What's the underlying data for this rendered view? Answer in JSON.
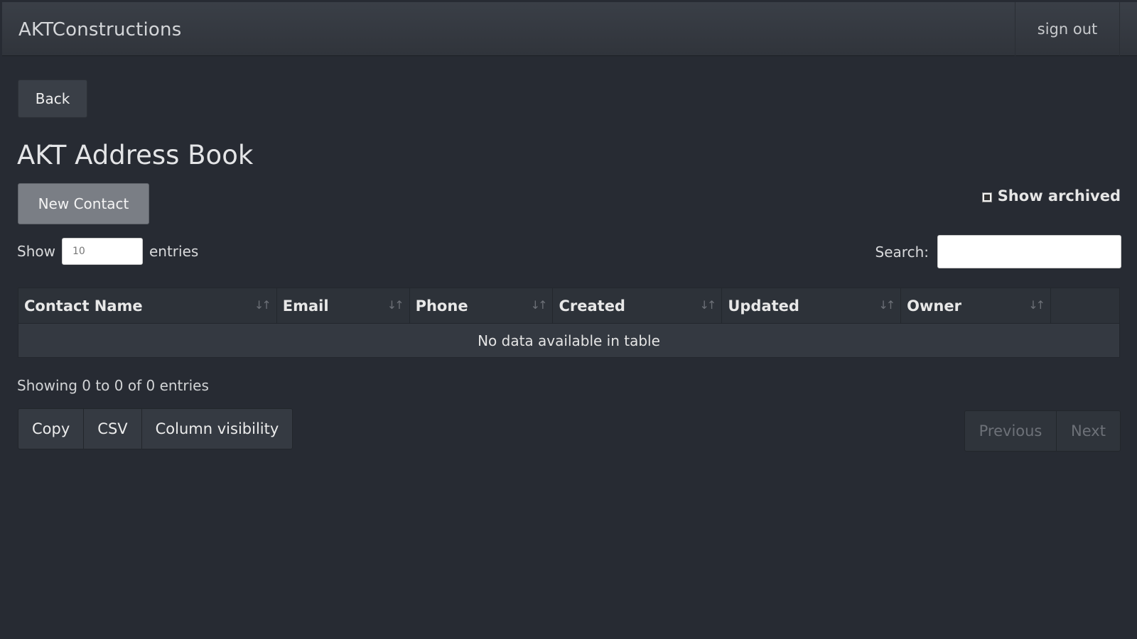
{
  "navbar": {
    "brand": "AKTConstructions",
    "sign_out": "sign out"
  },
  "back_label": "Back",
  "page_title": "AKT Address Book",
  "new_contact_label": "New Contact",
  "show_archived_label": "Show archived",
  "length": {
    "show_label": "Show",
    "value": "10",
    "entries_label": "entries"
  },
  "search": {
    "label": "Search:",
    "value": ""
  },
  "table": {
    "columns": [
      "Contact Name",
      "Email",
      "Phone",
      "Created",
      "Updated",
      "Owner",
      ""
    ],
    "empty_message": "No data available in table"
  },
  "info_text": "Showing 0 to 0 of 0 entries",
  "export_buttons": [
    "Copy",
    "CSV",
    "Column visibility"
  ],
  "pagination": {
    "previous": "Previous",
    "next": "Next"
  },
  "icons": {
    "sort": "sort-icon"
  },
  "colors": {
    "background": "#272b33",
    "navbar": "#353a42",
    "primary_button": "#7a7e85"
  }
}
